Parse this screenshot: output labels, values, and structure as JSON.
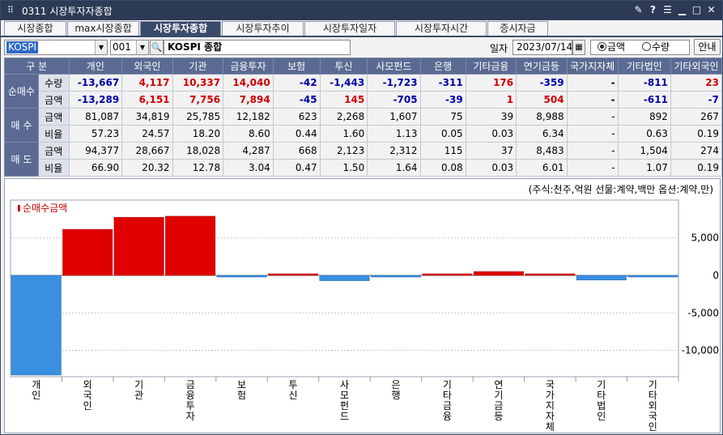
{
  "window": {
    "title": "0311 시장투자자종합",
    "buttons": [
      "✎",
      "?",
      "☰",
      "▁",
      "□",
      "✕"
    ]
  },
  "tabs": [
    {
      "label": "시장종합",
      "active": false
    },
    {
      "label": "max시장종합",
      "active": false
    },
    {
      "label": "시장투자종합",
      "active": true
    },
    {
      "label": "시장투자추이",
      "active": false
    },
    {
      "label": "시장투자일자",
      "active": false
    },
    {
      "label": "시장투자시간",
      "active": false
    },
    {
      "label": "증시자금",
      "active": false
    }
  ],
  "toolbar": {
    "market": "KOSPI",
    "code": "001",
    "stock_name": "KOSPI 종합",
    "date_label": "일자",
    "date": "2023/07/14",
    "radio_amount": "금액",
    "radio_qty": "수량",
    "help_label": "안내"
  },
  "table": {
    "corner": "구 분",
    "columns": [
      "개인",
      "외국인",
      "기관",
      "금융투자",
      "보험",
      "투신",
      "사모펀드",
      "은행",
      "기타금융",
      "연기금등",
      "국가지자체",
      "기타법인",
      "기타외국인"
    ],
    "groups": [
      {
        "label": "순매수",
        "rows": [
          {
            "label": "수량",
            "values": [
              "-13,667",
              "4,117",
              "10,337",
              "14,040",
              "-42",
              "-1,443",
              "-1,723",
              "-311",
              "176",
              "-359",
              "-",
              "-811",
              "23"
            ]
          },
          {
            "label": "금액",
            "values": [
              "-13,289",
              "6,151",
              "7,756",
              "7,894",
              "-45",
              "145",
              "-705",
              "-39",
              "1",
              "504",
              "-",
              "-611",
              "-7"
            ]
          }
        ]
      },
      {
        "label": "매 수",
        "rows": [
          {
            "label": "금액",
            "values": [
              "81,087",
              "34,819",
              "25,785",
              "12,182",
              "623",
              "2,268",
              "1,607",
              "75",
              "39",
              "8,988",
              "-",
              "892",
              "267"
            ]
          },
          {
            "label": "비율",
            "values": [
              "57.23",
              "24.57",
              "18.20",
              "8.60",
              "0.44",
              "1.60",
              "1.13",
              "0.05",
              "0.03",
              "6.34",
              "-",
              "0.63",
              "0.19"
            ]
          }
        ]
      },
      {
        "label": "매 도",
        "rows": [
          {
            "label": "금액",
            "values": [
              "94,377",
              "28,667",
              "18,028",
              "4,287",
              "668",
              "2,123",
              "2,312",
              "115",
              "37",
              "8,483",
              "-",
              "1,504",
              "274"
            ]
          },
          {
            "label": "비율",
            "values": [
              "66.90",
              "20.32",
              "12.78",
              "3.04",
              "0.47",
              "1.50",
              "1.64",
              "0.08",
              "0.03",
              "6.01",
              "-",
              "1.07",
              "0.19"
            ]
          }
        ]
      }
    ]
  },
  "unit_note": "(주식:천주,억원 선물:계약,백만 옵션:계약,만)",
  "chart_data": {
    "type": "bar",
    "series": [
      {
        "name": "순매수금액",
        "values": [
          -13289,
          6151,
          7756,
          7894,
          -45,
          145,
          -705,
          -39,
          1,
          504,
          0,
          -611,
          -7
        ]
      }
    ],
    "categories": [
      "개인",
      "외국인",
      "기관",
      "금융투자",
      "보험",
      "투신",
      "사모펀드",
      "은행",
      "기타금융",
      "연기금등",
      "국가지자체",
      "기타법인",
      "기타외국인"
    ],
    "y_ticks": [
      5000,
      0,
      -5000,
      -10000
    ],
    "y_tick_labels": [
      "5,000",
      "0",
      "-5,000",
      "-10,000"
    ],
    "ylim": [
      -13289,
      7894
    ],
    "colors": {
      "positive": "#e00000",
      "negative": "#3a8fe0"
    },
    "grid": true,
    "legend": "top-left"
  }
}
